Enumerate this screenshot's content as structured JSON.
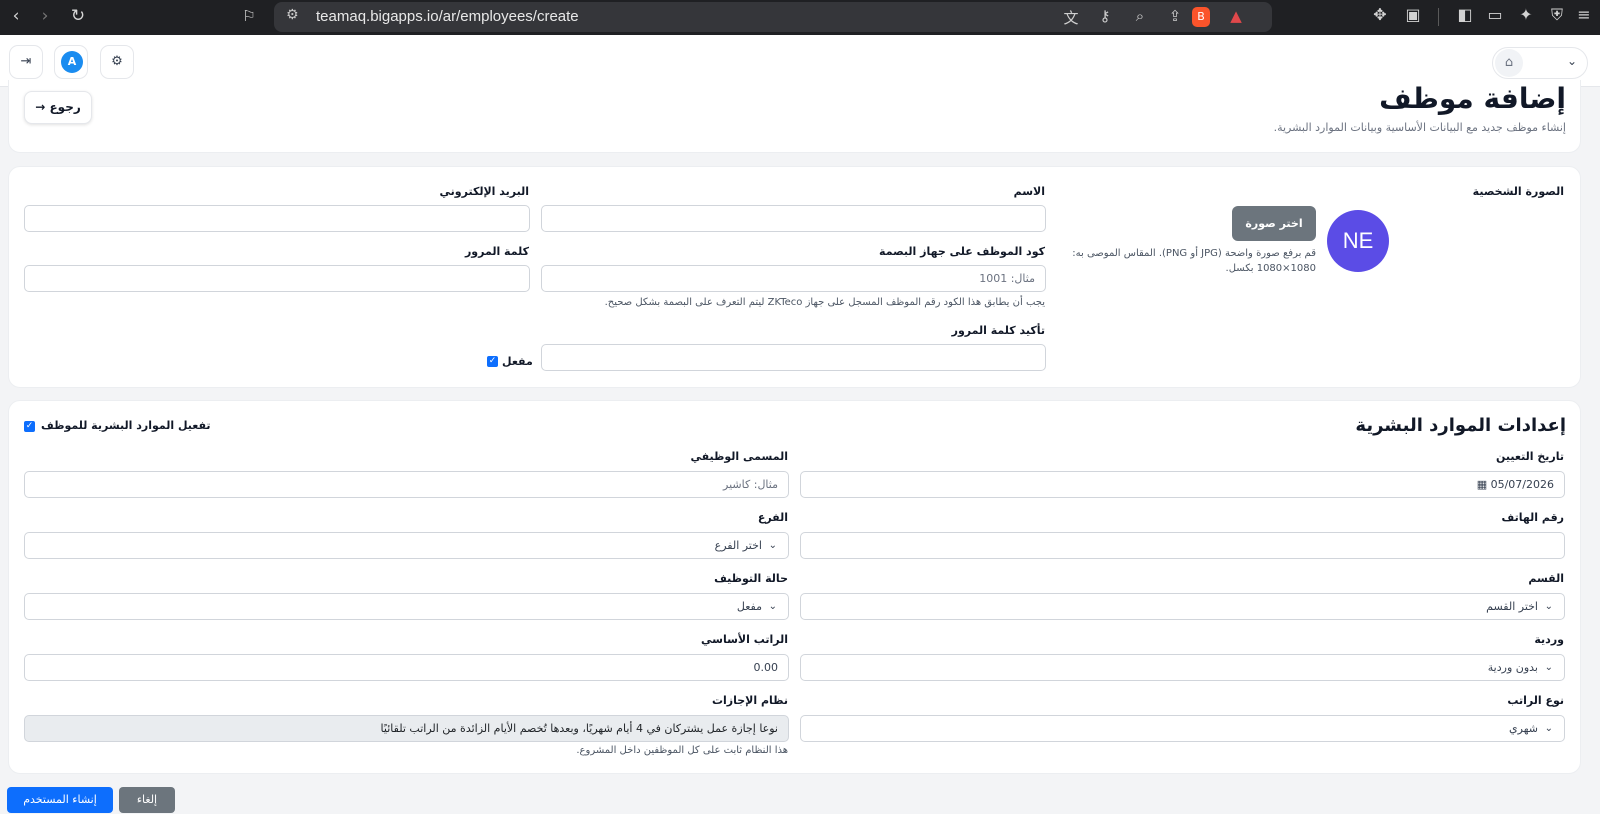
{
  "browser": {
    "url": "teamaq.bigapps.io/ar/employees/create"
  },
  "page": {
    "title": "إضافة موظف",
    "subtitle": "إنشاء موظف جديد مع البيانات الأساسية وبيانات الموارد البشرية.",
    "back_label": "رجوع"
  },
  "topbar": {
    "avatar_letter": "A"
  },
  "basic": {
    "photo_label": "الصورة الشخصية",
    "avatar_initials": "NE",
    "choose_photo_label": "اختر صورة",
    "photo_help_line1": "قم برفع صورة واضحة (JPG أو PNG). المقاس الموصى به:",
    "photo_help_line2": "1080×1080 بكسل.",
    "name_label": "الاسم",
    "name_value": "",
    "email_label": "البريد الإلكتروني",
    "email_value": "",
    "device_code_label": "كود الموظف على جهاز البصمة",
    "device_code_placeholder": "مثال: 1001",
    "device_code_help": "يجب أن يطابق هذا الكود رقم الموظف المسجل على جهاز ZKTeco ليتم التعرف على البصمة بشكل صحيح.",
    "password_label": "كلمة المرور",
    "password_value": "",
    "confirm_password_label": "تأكيد كلمة المرور",
    "confirm_password_value": "",
    "active_label": "مفعل",
    "active_checked": true
  },
  "hr": {
    "title": "إعدادات الموارد البشرية",
    "enable_label": "تفعيل الموارد البشرية للموظف",
    "enable_checked": true,
    "hire_date_label": "تاريخ التعيين",
    "hire_date_value": "05/07/2026",
    "job_title_label": "المسمى الوظيفي",
    "job_title_placeholder": "مثال: كاشير",
    "phone_label": "رقم الهاتف",
    "phone_value": "",
    "branch_label": "الفرع",
    "branch_value": "اختر الفرع",
    "department_label": "القسم",
    "department_value": "اختر القسم",
    "employment_status_label": "حالة التوظيف",
    "employment_status_value": "مفعل",
    "shift_label": "وردية",
    "shift_value": "بدون وردية",
    "base_salary_label": "الراتب الأساسي",
    "base_salary_value": "0.00",
    "salary_type_label": "نوع الراتب",
    "salary_type_value": "شهري",
    "leave_system_label": "نظام الإجازات",
    "leave_system_value": "نوعا إجازة عمل يشتركان في 4 أيام شهريًا، وبعدها تُخصم الأيام الزائدة من الراتب تلقائيًا",
    "leave_system_help": "هذا النظام ثابت على كل الموظفين داخل المشروع."
  },
  "actions": {
    "create_label": "إنشاء المستخدم",
    "cancel_label": "إلغاء"
  }
}
